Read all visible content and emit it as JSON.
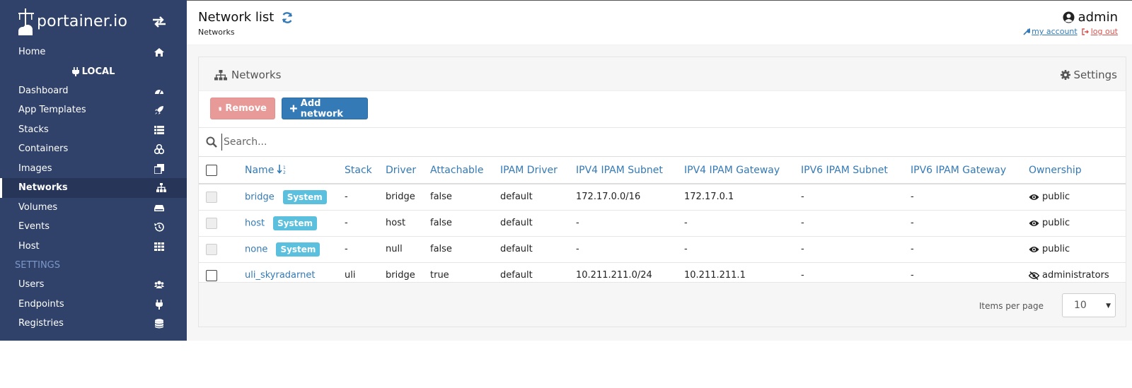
{
  "brand": {
    "name": "portainer.io"
  },
  "sidebar": {
    "items_top": [
      {
        "label": "Home",
        "icon": "home-icon"
      }
    ],
    "endpoint_label": "LOCAL",
    "items_endpoint": [
      {
        "label": "Dashboard",
        "icon": "tachometer-icon"
      },
      {
        "label": "App Templates",
        "icon": "rocket-icon"
      },
      {
        "label": "Stacks",
        "icon": "list-icon"
      },
      {
        "label": "Containers",
        "icon": "server-icon"
      },
      {
        "label": "Images",
        "icon": "clone-icon"
      },
      {
        "label": "Networks",
        "icon": "sitemap-icon",
        "active": true
      },
      {
        "label": "Volumes",
        "icon": "hdd-icon"
      },
      {
        "label": "Events",
        "icon": "history-icon"
      },
      {
        "label": "Host",
        "icon": "th-icon"
      }
    ],
    "section_label": "SETTINGS",
    "items_settings": [
      {
        "label": "Users",
        "icon": "users-icon"
      },
      {
        "label": "Endpoints",
        "icon": "plug-icon"
      },
      {
        "label": "Registries",
        "icon": "database-icon"
      }
    ]
  },
  "header": {
    "title": "Network list",
    "breadcrumb": "Networks",
    "user": "admin",
    "my_account": "my account",
    "log_out": "log out"
  },
  "widget": {
    "title": "Networks",
    "settings_label": "Settings",
    "remove_label": "Remove",
    "add_label": "Add network",
    "search_placeholder": "Search...",
    "columns": [
      "Name",
      "Stack",
      "Driver",
      "Attachable",
      "IPAM Driver",
      "IPV4 IPAM Subnet",
      "IPV4 IPAM Gateway",
      "IPV6 IPAM Subnet",
      "IPV6 IPAM Gateway",
      "Ownership"
    ],
    "rows": [
      {
        "name": "bridge",
        "system": "System",
        "stack": "-",
        "driver": "bridge",
        "attachable": "false",
        "ipam_driver": "default",
        "ipv4_subnet": "172.17.0.0/16",
        "ipv4_gateway": "172.17.0.1",
        "ipv6_subnet": "-",
        "ipv6_gateway": "-",
        "ownership": "public",
        "selectable": false
      },
      {
        "name": "host",
        "system": "System",
        "stack": "-",
        "driver": "host",
        "attachable": "false",
        "ipam_driver": "default",
        "ipv4_subnet": "-",
        "ipv4_gateway": "-",
        "ipv6_subnet": "-",
        "ipv6_gateway": "-",
        "ownership": "public",
        "selectable": false
      },
      {
        "name": "none",
        "system": "System",
        "stack": "-",
        "driver": "null",
        "attachable": "false",
        "ipam_driver": "default",
        "ipv4_subnet": "-",
        "ipv4_gateway": "-",
        "ipv6_subnet": "-",
        "ipv6_gateway": "-",
        "ownership": "public",
        "selectable": false
      },
      {
        "name": "uli_skyradarnet",
        "system": "",
        "stack": "uli",
        "driver": "bridge",
        "attachable": "true",
        "ipam_driver": "default",
        "ipv4_subnet": "10.211.211.0/24",
        "ipv4_gateway": "10.211.211.1",
        "ipv6_subnet": "-",
        "ipv6_gateway": "-",
        "ownership": "administrators",
        "selectable": true
      }
    ],
    "items_per_page_label": "Items per page",
    "items_per_page_value": "10"
  },
  "colors": {
    "sidebar_bg": "#30426a",
    "link": "#337ab7",
    "badge": "#5bc0de",
    "danger": "#d9534f"
  }
}
